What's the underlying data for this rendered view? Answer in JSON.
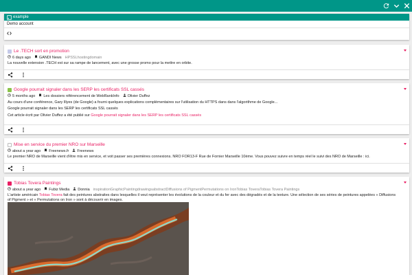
{
  "topbar": {
    "color": "#009688",
    "icons": [
      "refresh-icon",
      "expand-icon",
      "close-icon"
    ]
  },
  "feed": {
    "title": "example",
    "subtitle": "Demo account"
  },
  "cards": [
    {
      "title": "Le .TECH sort en promotion",
      "time": "6 days ago",
      "source": "GANDI News",
      "tags": "HPSSLhostingdomain",
      "body": "La nouvelle extension .TECH est sur sa rampe de lancement, avec une grosse promo pour la mettre en orbite."
    },
    {
      "title": "Google pourrait signaler dans les SERP les certificats SSL cassés",
      "time": "5 months ago",
      "source": "Les dossiers référencement de WebRankInfo",
      "author": "Olivier Duffez",
      "body_line1": "Au cours d'une conférence, Gary Illyes (de Google) a fourni quelques explications complémentaires sur l'utilisation du HTTPS dans dans l'algorithme de Google...",
      "body_link": "Google pourrait signaler dans les SERP les certificats SSL cassés",
      "body_line3_prefix": "Cet article écrit par Olivier Duffez a été publié sur ",
      "body_line3_link": "Google pourrait signaler dans les SERP les certificats SSL cassés"
    },
    {
      "title": "Mise en service du premier NRO sur Marseille",
      "time": "about a year ago",
      "source": "Freenews.fr",
      "author": "Freenews",
      "body": "Le premier NRO de Marseille vient d'être mis en service, et voit passer ses premières connexions. NRO FOR13-F Rue de Fornier Marseille 10ème. Vous pouvez suivre en temps réel le suivi des NRO de Marseille : ici."
    },
    {
      "title": "Tobias Tovera Paintings",
      "time": "about a year ago",
      "source": "Fubiz Media",
      "author": "Donnia",
      "tags": "inspirationGraphicPaintingdrawingsabstractDiffusions of PigmentPermutations on IronTobias ToveraTobias Tovera Paintings",
      "body_prefix": "L'artiste américain ",
      "body_link": "Tobias Tovera",
      "body_suffix": " fait des peintures abstraites dans lesquelles il veut représenter les évolutions de la couleur et du fer avec des dégradés et de la texture. Une sélection de ses séries de peintures appelées « Diffusions",
      "body_line2": "of Pigment » et « Permutations on Iron » sont à découvrir en images."
    }
  ]
}
